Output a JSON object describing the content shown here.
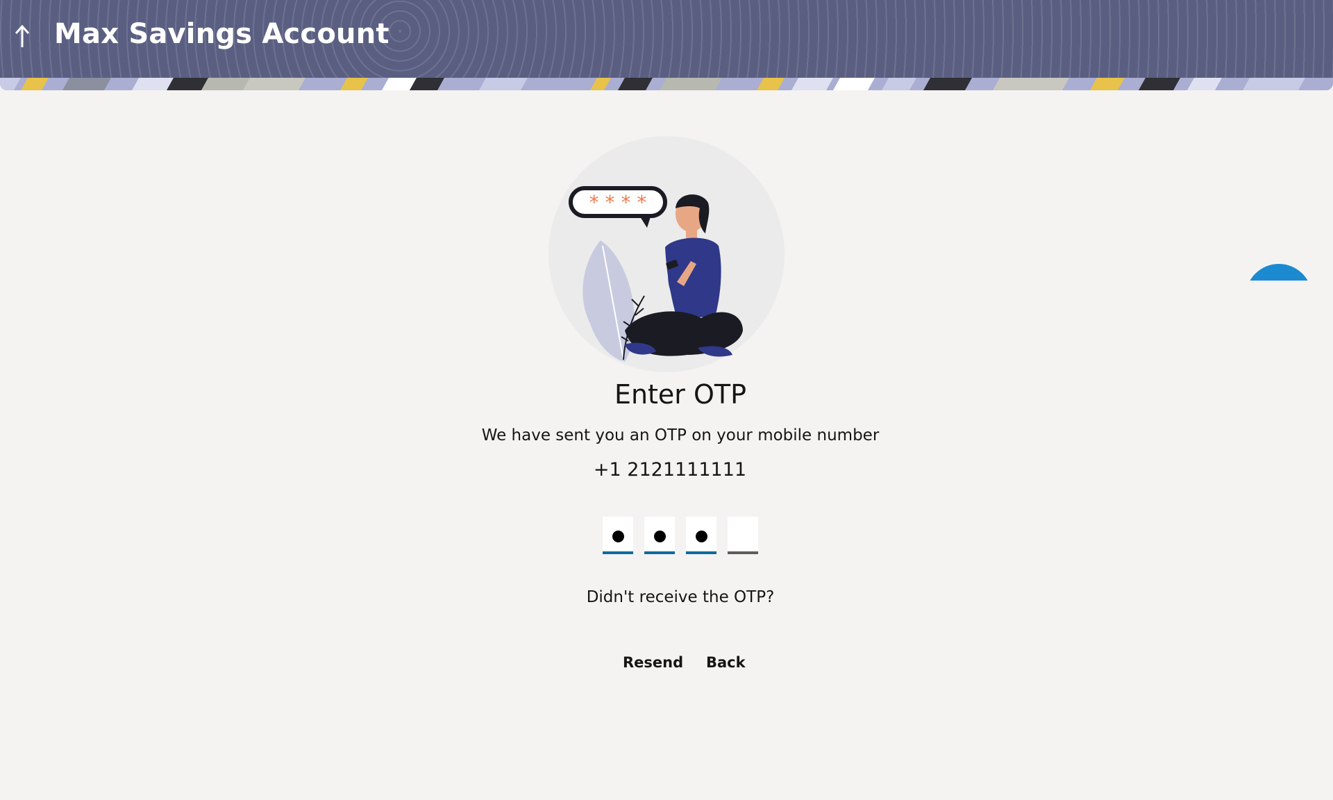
{
  "header": {
    "title": "Max Savings Account",
    "back_icon": "up-arrow-icon",
    "background_color": "#5a5f82"
  },
  "illustration": {
    "speech_bubble_text": "* * * *",
    "accent_color": "#ee7b4d",
    "figure_color": "#30388a"
  },
  "otp": {
    "title": "Enter OTP",
    "subtitle": "We have sent you an OTP on your mobile number",
    "phone_number": "+1 2121111111",
    "digits_filled": 3,
    "digits_total": 4,
    "filled_underline_color": "#0f6b9c",
    "empty_underline_color": "#5d5d5d"
  },
  "resend": {
    "question": "Didn't receive the OTP?",
    "resend_label": "Resend",
    "back_label": "Back"
  },
  "chat": {
    "icon": "chat-bubble-icon",
    "color": "#1c8ad0"
  }
}
